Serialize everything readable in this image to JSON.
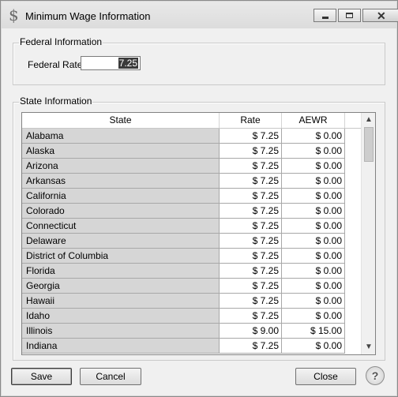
{
  "window": {
    "title": "Minimum Wage Information",
    "app_icon": "$"
  },
  "federal": {
    "group_title": "Federal Information",
    "rate_label": "Federal Rate",
    "rate_value": "7.25"
  },
  "state": {
    "group_title": "State Information",
    "columns": [
      "State",
      "Rate",
      "AEWR"
    ],
    "rows": [
      {
        "state": "Alabama",
        "rate": "$ 7.25",
        "aewr": "$ 0.00"
      },
      {
        "state": "Alaska",
        "rate": "$ 7.25",
        "aewr": "$ 0.00"
      },
      {
        "state": "Arizona",
        "rate": "$ 7.25",
        "aewr": "$ 0.00"
      },
      {
        "state": "Arkansas",
        "rate": "$ 7.25",
        "aewr": "$ 0.00"
      },
      {
        "state": "California",
        "rate": "$ 7.25",
        "aewr": "$ 0.00"
      },
      {
        "state": "Colorado",
        "rate": "$ 7.25",
        "aewr": "$ 0.00"
      },
      {
        "state": "Connecticut",
        "rate": "$ 7.25",
        "aewr": "$ 0.00"
      },
      {
        "state": "Delaware",
        "rate": "$ 7.25",
        "aewr": "$ 0.00"
      },
      {
        "state": "District of Columbia",
        "rate": "$ 7.25",
        "aewr": "$ 0.00"
      },
      {
        "state": "Florida",
        "rate": "$ 7.25",
        "aewr": "$ 0.00"
      },
      {
        "state": "Georgia",
        "rate": "$ 7.25",
        "aewr": "$ 0.00"
      },
      {
        "state": "Hawaii",
        "rate": "$ 7.25",
        "aewr": "$ 0.00"
      },
      {
        "state": "Idaho",
        "rate": "$ 7.25",
        "aewr": "$ 0.00"
      },
      {
        "state": "Illinois",
        "rate": "$ 9.00",
        "aewr": "$ 15.00"
      },
      {
        "state": "Indiana",
        "rate": "$ 7.25",
        "aewr": "$ 0.00"
      }
    ]
  },
  "buttons": {
    "save": "Save",
    "cancel": "Cancel",
    "close": "Close",
    "help": "?"
  },
  "icons": {
    "app": "dollar-sign-icon",
    "minimize": "minimize-icon",
    "maximize": "maximize-icon",
    "close": "close-icon",
    "scroll_up": "chevron-up-icon",
    "scroll_down": "chevron-down-icon",
    "help": "help-icon"
  }
}
